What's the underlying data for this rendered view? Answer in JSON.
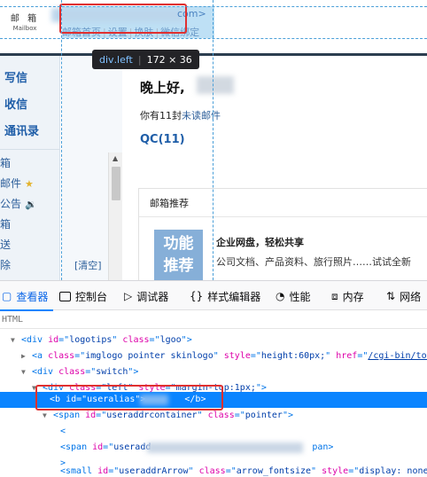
{
  "mailbox": {
    "logo_cn": "邮 箱",
    "logo_en": "Mailbox",
    "addr_suffix": "com>",
    "toplinks": [
      "邮箱首页",
      "设置",
      "换肤",
      "微信绑定"
    ],
    "nav_main": [
      "写信",
      "收信",
      "通讯录"
    ],
    "nav_sub": [
      {
        "label": "箱",
        "icon": ""
      },
      {
        "label": "邮件",
        "icon": "star-icon"
      },
      {
        "label": "公告",
        "icon": "speaker-icon"
      },
      {
        "label": "箱",
        "icon": ""
      },
      {
        "label": "送",
        "icon": ""
      },
      {
        "label": "除",
        "icon": ""
      }
    ],
    "clear_link": "[清空]",
    "greeting": "晚上好,",
    "unread_prefix": "你有11封",
    "unread_link": "未读邮件",
    "qc_label": "QC(11)",
    "panel_title": "邮箱推荐",
    "badge_line1": "功能",
    "badge_line2": "推荐",
    "feature_title": "企业网盘，轻松共享",
    "feature_desc": "公司文档、产品资料、旅行照片……试试全新"
  },
  "tooltip": {
    "tag": "div",
    "cls": ".left",
    "size": "172 × 36"
  },
  "devtools": {
    "tabs": [
      {
        "label": "查看器",
        "icon": "inspector-icon",
        "active": true
      },
      {
        "label": "控制台",
        "icon": "console-icon",
        "active": false
      },
      {
        "label": "调试器",
        "icon": "debugger-icon",
        "active": false
      },
      {
        "label": "样式编辑器",
        "icon": "style-editor-icon",
        "active": false
      },
      {
        "label": "性能",
        "icon": "performance-icon",
        "active": false
      },
      {
        "label": "内存",
        "icon": "memory-icon",
        "active": false
      },
      {
        "label": "网络",
        "icon": "network-icon",
        "active": false
      }
    ],
    "breadcrumb": "HTML",
    "markup": {
      "l1_id": "logotips",
      "l1_class": "lgoo",
      "l2_class": "imglogo pointer skinlogo",
      "l2_style": "height:60px;",
      "l2_href": "/cgi-bin/tod",
      "l3_class": "switch",
      "l4_class": "left",
      "l4_style": "margin-top:1px;",
      "l5_id": "useralias",
      "l6_id": "useraddrcontainer",
      "l6_class": "pointer",
      "l8_id": "useradd",
      "l8_tail": "pan>",
      "l10_id": "useraddrArrow",
      "l10_class": "arrow_fontsize",
      "l10_style": "display: none"
    }
  }
}
